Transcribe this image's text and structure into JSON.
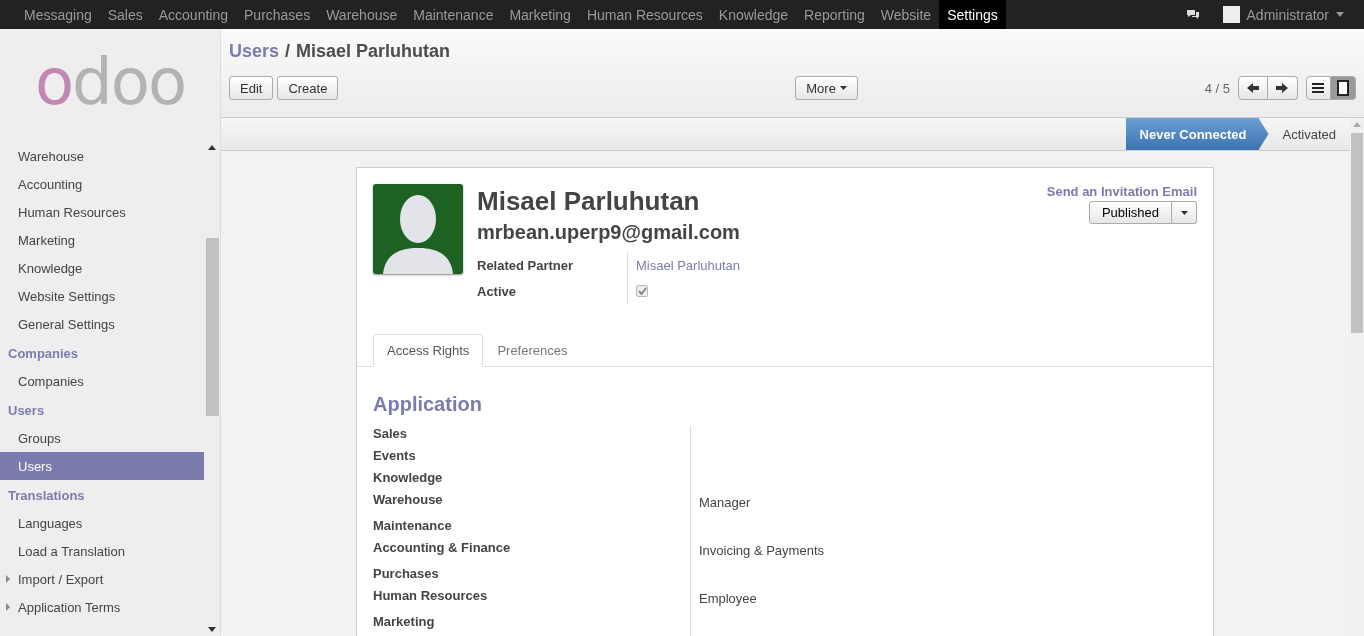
{
  "top_menu": [
    {
      "label": "Messaging",
      "selected": false
    },
    {
      "label": "Sales",
      "selected": false
    },
    {
      "label": "Accounting",
      "selected": false
    },
    {
      "label": "Purchases",
      "selected": false
    },
    {
      "label": "Warehouse",
      "selected": false
    },
    {
      "label": "Maintenance",
      "selected": false
    },
    {
      "label": "Marketing",
      "selected": false
    },
    {
      "label": "Human Resources",
      "selected": false
    },
    {
      "label": "Knowledge",
      "selected": false
    },
    {
      "label": "Reporting",
      "selected": false
    },
    {
      "label": "Website",
      "selected": false
    },
    {
      "label": "Settings",
      "selected": true
    }
  ],
  "user_menu": {
    "label": "Administrator"
  },
  "logo": {
    "text": "odoo"
  },
  "sidebar": {
    "items": [
      {
        "kind": "item",
        "label": "Warehouse",
        "selected": false
      },
      {
        "kind": "item",
        "label": "Accounting",
        "selected": false
      },
      {
        "kind": "item",
        "label": "Human Resources",
        "selected": false
      },
      {
        "kind": "item",
        "label": "Marketing",
        "selected": false
      },
      {
        "kind": "item",
        "label": "Knowledge",
        "selected": false
      },
      {
        "kind": "item",
        "label": "Website Settings",
        "selected": false
      },
      {
        "kind": "item",
        "label": "General Settings",
        "selected": false
      },
      {
        "kind": "header",
        "label": "Companies"
      },
      {
        "kind": "item",
        "label": "Companies",
        "selected": false
      },
      {
        "kind": "header",
        "label": "Users"
      },
      {
        "kind": "item",
        "label": "Groups",
        "selected": false
      },
      {
        "kind": "item",
        "label": "Users",
        "selected": true
      },
      {
        "kind": "header",
        "label": "Translations"
      },
      {
        "kind": "item",
        "label": "Languages",
        "selected": false
      },
      {
        "kind": "item",
        "label": "Load a Translation",
        "selected": false
      },
      {
        "kind": "expandable",
        "label": "Import / Export",
        "selected": false
      },
      {
        "kind": "expandable",
        "label": "Application Terms",
        "selected": false
      }
    ]
  },
  "breadcrumb": {
    "parent": "Users",
    "separator": "/",
    "current": "Misael Parluhutan"
  },
  "buttons": {
    "edit": "Edit",
    "create": "Create",
    "more": "More"
  },
  "pager": {
    "text": "4 / 5"
  },
  "views": [
    {
      "kind": "list",
      "selected": false
    },
    {
      "kind": "form",
      "selected": true
    }
  ],
  "stages": [
    {
      "label": "Never Connected",
      "selected": true
    },
    {
      "label": "Activated",
      "selected": false
    }
  ],
  "form": {
    "name": "Misael Parluhutan",
    "email": "mrbean.uperp9@gmail.com",
    "invite_link": "Send an Invitation Email",
    "publish_button": "Published",
    "fields": [
      {
        "label": "Related Partner",
        "kind": "link",
        "value": "Misael Parluhutan"
      },
      {
        "label": "Active",
        "kind": "checkbox",
        "checked": true
      }
    ],
    "tabs": [
      {
        "label": "Access Rights",
        "selected": true
      },
      {
        "label": "Preferences",
        "selected": false
      }
    ],
    "section_title": "Application",
    "rights": [
      {
        "label": "Sales"
      },
      {
        "label": "Events"
      },
      {
        "label": "Knowledge"
      },
      {
        "label": "Warehouse",
        "value": "Manager"
      },
      {
        "label": "Maintenance"
      },
      {
        "label": "Accounting & Finance",
        "value": "Invoicing & Payments"
      },
      {
        "label": "Purchases"
      },
      {
        "label": "Human Resources",
        "value": "Employee"
      },
      {
        "label": "Marketing"
      }
    ]
  }
}
